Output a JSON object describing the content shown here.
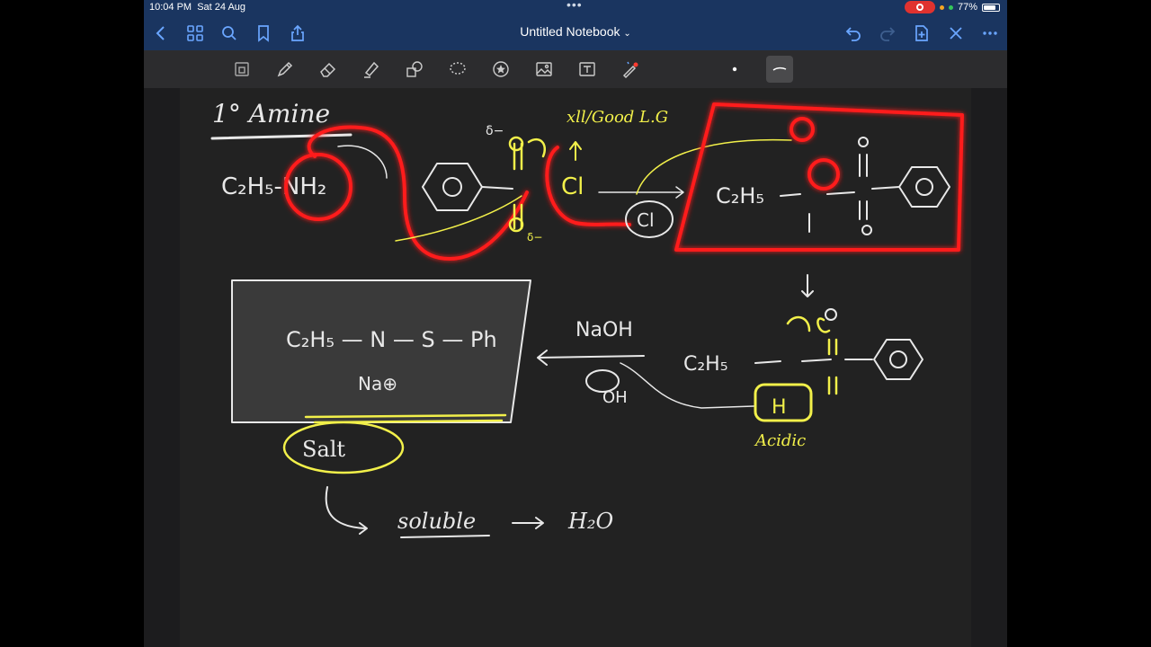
{
  "status": {
    "time": "10:04 PM",
    "date": "Sat 24 Aug",
    "battery": "77%"
  },
  "nav": {
    "title": "Untitled Notebook",
    "left_icons": [
      "back-icon",
      "grid-icon",
      "search-icon",
      "bookmark-icon",
      "share-icon"
    ],
    "right_icons": [
      "undo-icon",
      "redo-icon",
      "add-page-icon",
      "close-icon",
      "more-icon"
    ]
  },
  "toolbar": {
    "tools": [
      "zoom",
      "pen",
      "eraser",
      "highlighter",
      "shapes",
      "lasso",
      "sticker",
      "image",
      "text",
      "laser"
    ],
    "selected": "stroke-style"
  },
  "notes": {
    "heading": "1° Amine",
    "reagent_note": "xll/Good L.G",
    "amine": "C₂H₅-NH₂",
    "chloride": "Cl",
    "chloride_ion": "Cl",
    "sulfonamide_group": "C₂H₅",
    "naoh": "NaOH",
    "salt_formula_left": "C₂H₅ — N — S — Ph",
    "salt_na": "Na⊕",
    "salt": "Salt",
    "soluble": "soluble",
    "arrow_to": "H₂O",
    "acidic": "Acidic",
    "oh": "OH",
    "delta_minus": "δ−"
  },
  "colors": {
    "ink": "#e8e8e8",
    "yellow": "#f2f04a",
    "red": "#ff1a1a",
    "bar": "#1a3560"
  }
}
